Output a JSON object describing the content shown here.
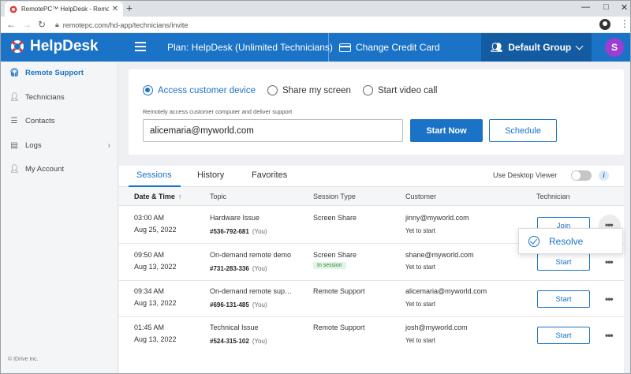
{
  "browser": {
    "tab_title": "RemotePC™ HelpDesk - Remote",
    "tab_close": "✕",
    "new_tab": "+",
    "url": "remotepc.com/hd-app/technicians/invite"
  },
  "header": {
    "logo": "HelpDesk",
    "plan": "Plan: HelpDesk (Unlimited Technicians)",
    "change_card": "Change Credit Card",
    "group": "Default Group",
    "avatar": "S"
  },
  "colors": {
    "brand": "#1a73c6",
    "avatar": "#9b3fd1",
    "in_session": "#2e8b3d"
  },
  "sidebar": {
    "items": [
      {
        "label": "Remote Support",
        "icon": "headset-icon"
      },
      {
        "label": "Technicians",
        "icon": "technicians-icon"
      },
      {
        "label": "Contacts",
        "icon": "contacts-icon"
      },
      {
        "label": "Logs",
        "icon": "logs-icon"
      },
      {
        "label": "My Account",
        "icon": "user-icon"
      }
    ],
    "copyright": "© IDrive Inc."
  },
  "connect": {
    "options": [
      "Access customer device",
      "Share my screen",
      "Start video call"
    ],
    "selected": "Access customer device",
    "hint": "Remotely access customer computer and deliver support",
    "email_value": "alicemaria@myworld.com",
    "start_now": "Start Now",
    "schedule": "Schedule"
  },
  "sessions": {
    "tabs": [
      "Sessions",
      "History",
      "Favorites"
    ],
    "active_tab": "Sessions",
    "desktop_viewer_label": "Use Desktop Viewer",
    "desktop_viewer_on": false,
    "info": "i",
    "columns": [
      "Date & Time",
      "Topic",
      "Session Type",
      "Customer",
      "Technician"
    ],
    "sort_arrow": "↑",
    "you": "(You)",
    "rows": [
      {
        "time": "03:00 AM",
        "date": "Aug 25, 2022",
        "topic": "Hardware Issue",
        "id": "#536-792-681",
        "type": "Screen Share",
        "badge": "",
        "customer": "jinny@myworld.com",
        "status": "Yet to start",
        "action": "Join"
      },
      {
        "time": "09:50 AM",
        "date": "Aug 13, 2022",
        "topic": "On-demand remote demo",
        "id": "#731-283-336",
        "type": "Screen Share",
        "badge": "In session",
        "customer": "shane@myworld.com",
        "status": "Yet to start",
        "action": "Start"
      },
      {
        "time": "09:34 AM",
        "date": "Aug 13, 2022",
        "topic": "On-demand remote sup…",
        "id": "#696-131-485",
        "type": "Remote Support",
        "badge": "",
        "customer": "alicemaria@myworld.com",
        "status": "Yet to start",
        "action": "Start"
      },
      {
        "time": "01:45 AM",
        "date": "Aug 13, 2022",
        "topic": "Technical Issue",
        "id": "#524-315-102",
        "type": "Remote Support",
        "badge": "",
        "customer": "josh@myworld.com",
        "status": "Yet to start",
        "action": "Start"
      }
    ],
    "more": "•••",
    "popup": {
      "label": "Resolve"
    }
  }
}
